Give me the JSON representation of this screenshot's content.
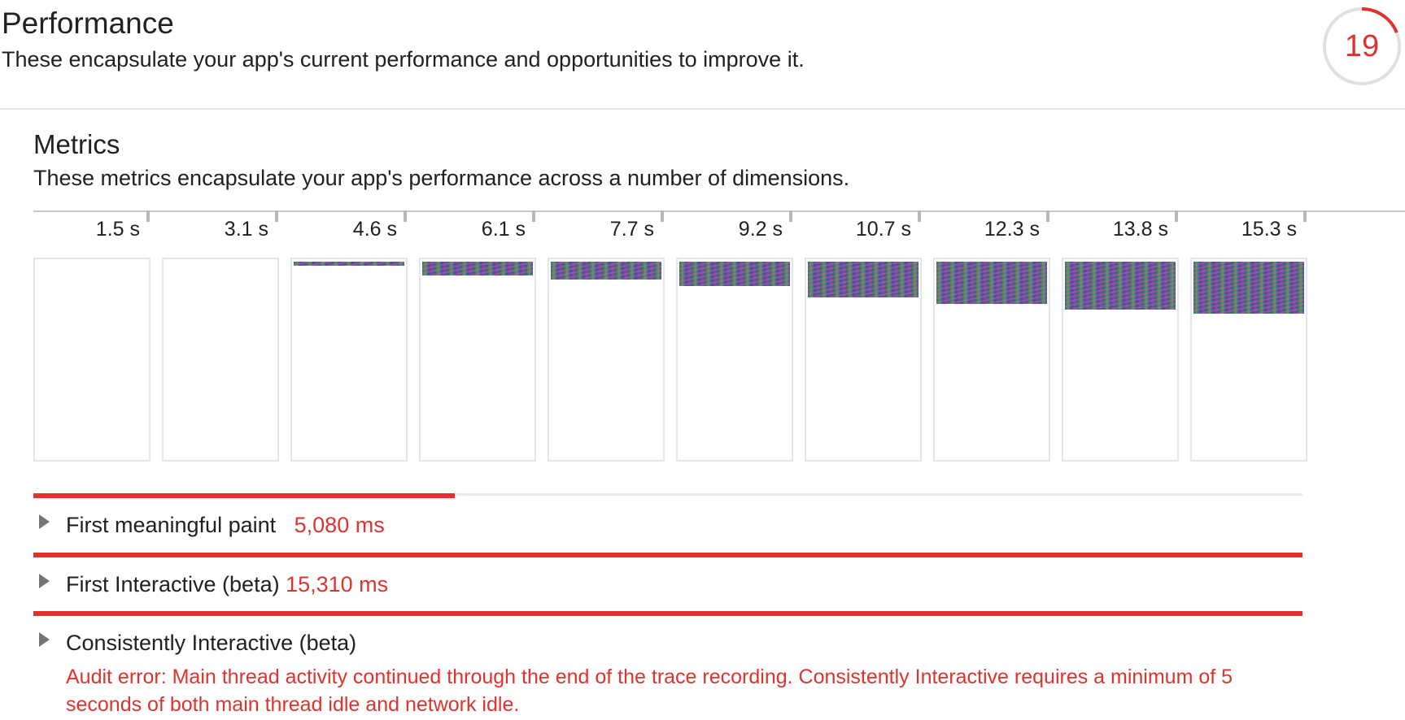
{
  "section": {
    "title": "Performance",
    "description": "These encapsulate your app's current performance and opportunities to improve it.",
    "score": "19",
    "score_fraction": 0.19,
    "score_color": "#df332f"
  },
  "metrics_group": {
    "title": "Metrics",
    "description": "These metrics encapsulate your app's performance across a number of dimensions."
  },
  "filmstrip": {
    "frames": [
      {
        "time": "1.5 s",
        "paint_fraction": 0.0
      },
      {
        "time": "3.1 s",
        "paint_fraction": 0.0
      },
      {
        "time": "4.6 s",
        "paint_fraction": 0.02
      },
      {
        "time": "6.1 s",
        "paint_fraction": 0.07
      },
      {
        "time": "7.7 s",
        "paint_fraction": 0.09
      },
      {
        "time": "9.2 s",
        "paint_fraction": 0.12
      },
      {
        "time": "10.7 s",
        "paint_fraction": 0.18
      },
      {
        "time": "12.3 s",
        "paint_fraction": 0.21
      },
      {
        "time": "13.8 s",
        "paint_fraction": 0.24
      },
      {
        "time": "15.3 s",
        "paint_fraction": 0.26
      }
    ]
  },
  "metrics": [
    {
      "name": "First meaningful paint",
      "value": "5,080 ms",
      "bar_fraction": 0.332,
      "error": ""
    },
    {
      "name": "First Interactive (beta)",
      "value": "15,310 ms",
      "bar_fraction": 1.0,
      "error": ""
    },
    {
      "name": "Consistently Interactive (beta)",
      "value": "",
      "bar_fraction": 1.0,
      "error": "Audit error: Main thread activity continued through the end of the trace recording. Consistently Interactive requires a minimum of 5 seconds of both main thread idle and network idle."
    }
  ],
  "icons": {
    "expand": "expand-triangle-icon",
    "gauge": "score-gauge-icon"
  }
}
